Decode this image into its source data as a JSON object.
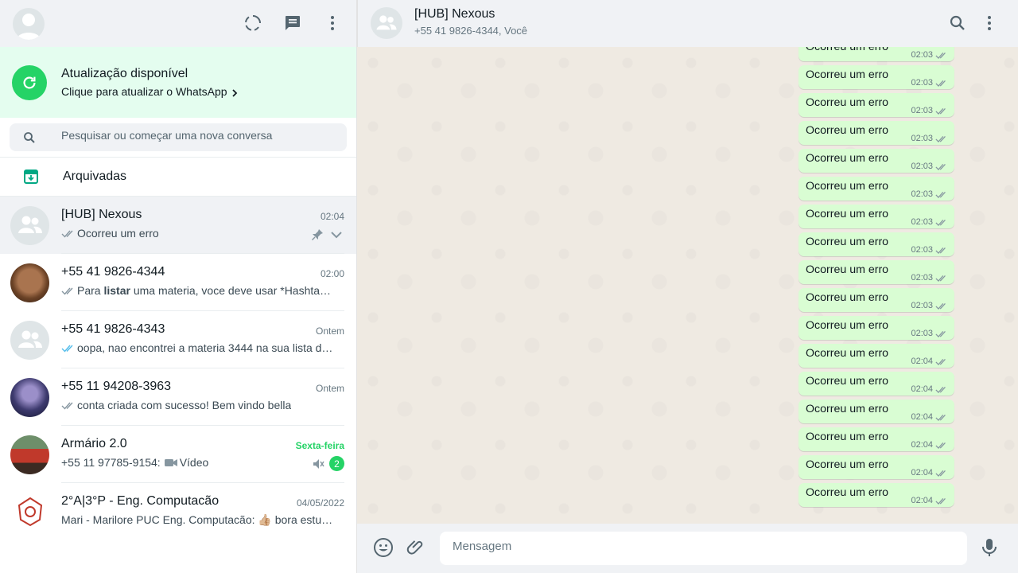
{
  "left_header": {
    "icons": [
      "status-icon",
      "new-chat-icon",
      "menu-icon"
    ]
  },
  "update_banner": {
    "title": "Atualização disponível",
    "subtitle": "Clique para atualizar o WhatsApp"
  },
  "search": {
    "placeholder": "Pesquisar ou começar uma nova conversa"
  },
  "archived": {
    "label": "Arquivadas"
  },
  "chats": [
    {
      "name": "[HUB] Nexous",
      "time": "02:04",
      "preview": "Ocorreu um erro",
      "ticks": "grey",
      "pinned": true
    },
    {
      "name": "+55 41 9826-4344",
      "time": "02:00",
      "preview_prefix": "Para ",
      "preview_bold": "listar",
      "preview_suffix": " uma materia, voce deve usar *Hashta…",
      "ticks": "grey"
    },
    {
      "name": "+55 41 9826-4343",
      "time": "Ontem",
      "preview": "oopa, nao encontrei a materia 3444 na sua lista d…",
      "ticks": "blue"
    },
    {
      "name": "+55 11 94208-3963",
      "time": "Ontem",
      "preview": "conta criada com sucesso! Bem vindo  bella",
      "ticks": "grey"
    },
    {
      "name": "Armário 2.0",
      "time": "Sexta-feira",
      "preview_sender": "+55 11 97785-9154:",
      "preview_media": "Vídeo",
      "unread": "2",
      "muted": true
    },
    {
      "name": "2°A|3°P - Eng. Computacão",
      "time": "04/05/2022",
      "preview": "Mari - Marilore PUC Eng. Computacão: 👍🏼 bora estu…"
    }
  ],
  "conversation": {
    "title": "[HUB] Nexous",
    "subtitle": "+55 41 9826-4344, Você",
    "messages": [
      {
        "text": "Ocorreu um erro",
        "time": "02:03"
      },
      {
        "text": "Ocorreu um erro",
        "time": "02:03"
      },
      {
        "text": "Ocorreu um erro",
        "time": "02:03"
      },
      {
        "text": "Ocorreu um erro",
        "time": "02:03"
      },
      {
        "text": "Ocorreu um erro",
        "time": "02:03"
      },
      {
        "text": "Ocorreu um erro",
        "time": "02:03"
      },
      {
        "text": "Ocorreu um erro",
        "time": "02:03"
      },
      {
        "text": "Ocorreu um erro",
        "time": "02:03"
      },
      {
        "text": "Ocorreu um erro",
        "time": "02:03"
      },
      {
        "text": "Ocorreu um erro",
        "time": "02:03"
      },
      {
        "text": "Ocorreu um erro",
        "time": "02:03"
      },
      {
        "text": "Ocorreu um erro",
        "time": "02:04"
      },
      {
        "text": "Ocorreu um erro",
        "time": "02:04"
      },
      {
        "text": "Ocorreu um erro",
        "time": "02:04"
      },
      {
        "text": "Ocorreu um erro",
        "time": "02:04"
      },
      {
        "text": "Ocorreu um erro",
        "time": "02:04"
      },
      {
        "text": "Ocorreu um erro",
        "time": "02:04"
      }
    ]
  },
  "composer": {
    "placeholder": "Mensagem"
  },
  "colors": {
    "accent": "#25d366",
    "bubble_out": "#d9fdd3",
    "panel": "#f0f2f5",
    "wallpaper": "#efeae2",
    "read_tick": "#53bdeb"
  }
}
